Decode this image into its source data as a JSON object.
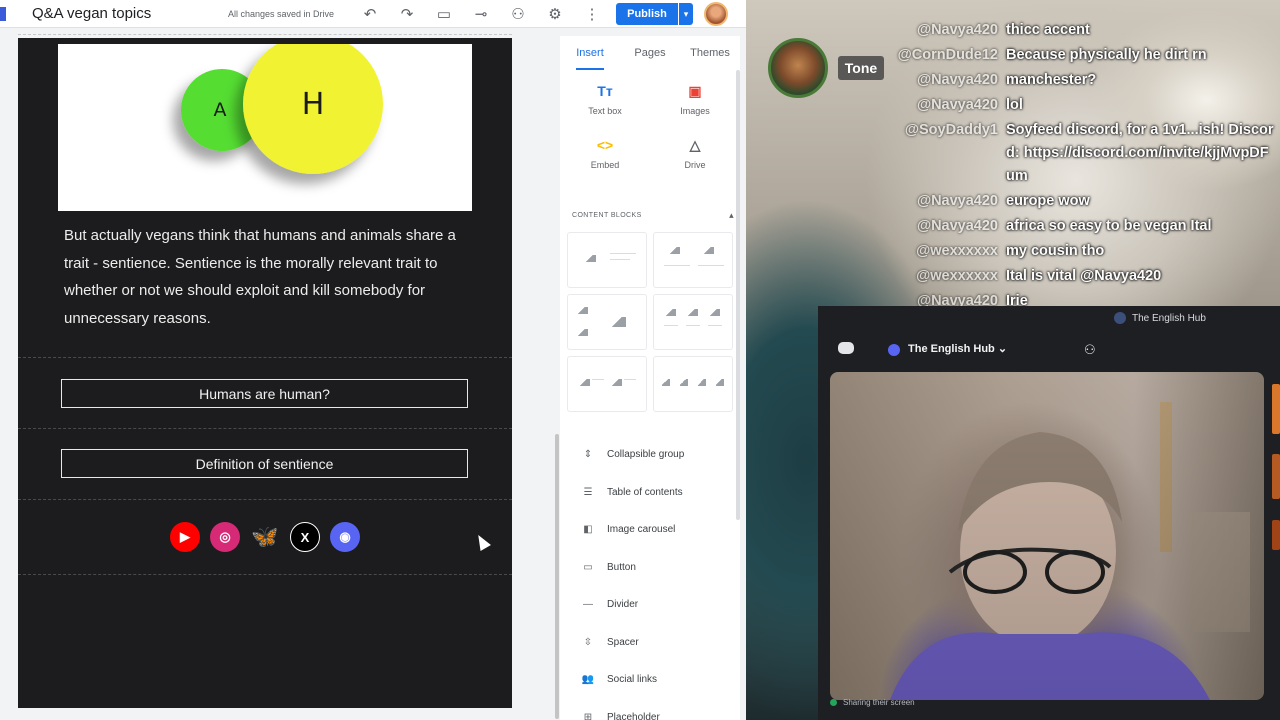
{
  "editor": {
    "title": "Q&A vegan topics",
    "save_status": "All changes saved in Drive",
    "publish_label": "Publish",
    "toolbar_icons": [
      "undo-icon",
      "redo-icon",
      "preview-icon",
      "link-icon",
      "share-icon",
      "settings-icon",
      "more-icon"
    ]
  },
  "page": {
    "venn": {
      "left_label": "A",
      "right_label": "H",
      "left_color": "#55dd33",
      "right_color": "#f1f230"
    },
    "paragraph": "But actually vegans think that humans and animals share a trait - sentience. Sentience is the morally relevant trait to whether or not we should exploit and kill somebody for unnecessary reasons.",
    "buttons": [
      "Humans are human?",
      "Definition of sentience"
    ],
    "social_icons": [
      {
        "name": "youtube-icon",
        "glyph": "▶",
        "color": "#ff0000"
      },
      {
        "name": "instagram-icon",
        "glyph": "◎",
        "color": "#d62976"
      },
      {
        "name": "bluesky-icon",
        "glyph": "🦋",
        "color": "#1185fe"
      },
      {
        "name": "x-icon",
        "glyph": "X",
        "color": "#000000"
      },
      {
        "name": "discord-icon",
        "glyph": "◉",
        "color": "#5865f2"
      }
    ]
  },
  "sidepanel": {
    "tabs": [
      "Insert",
      "Pages",
      "Themes"
    ],
    "insert_items": [
      {
        "label": "Text box",
        "icon": "text-box-icon",
        "glyph": "Tт",
        "color": "#1a73e8"
      },
      {
        "label": "Images",
        "icon": "images-icon",
        "glyph": "▣",
        "color": "#ea4335"
      },
      {
        "label": "Embed",
        "icon": "embed-icon",
        "glyph": "<>",
        "color": "#fbbc04"
      },
      {
        "label": "Drive",
        "icon": "drive-icon",
        "glyph": "△",
        "color": "#5f6368"
      }
    ],
    "content_blocks_heading": "CONTENT BLOCKS",
    "components": [
      {
        "label": "Collapsible group",
        "icon": "collapsible-icon",
        "glyph": "⇕"
      },
      {
        "label": "Table of contents",
        "icon": "toc-icon",
        "glyph": "☰"
      },
      {
        "label": "Image carousel",
        "icon": "carousel-icon",
        "glyph": "◧"
      },
      {
        "label": "Button",
        "icon": "button-icon",
        "glyph": "▭"
      },
      {
        "label": "Divider",
        "icon": "divider-icon",
        "glyph": "—"
      },
      {
        "label": "Spacer",
        "icon": "spacer-icon",
        "glyph": "⇳"
      },
      {
        "label": "Social links",
        "icon": "social-links-icon",
        "glyph": "👥"
      },
      {
        "label": "Placeholder",
        "icon": "placeholder-icon",
        "glyph": "⊞"
      }
    ]
  },
  "stream": {
    "streamer_name": "Tone",
    "chat": [
      {
        "user": "@Navya420",
        "text": "thicc accent"
      },
      {
        "user": "@CornDude12",
        "text": "Because physically he dirt rn"
      },
      {
        "user": "@Navya420",
        "text": "manchester?"
      },
      {
        "user": "@Navya420",
        "text": "lol"
      },
      {
        "user": "@SoyDaddy1",
        "text": "Soyfeed discord, for a 1v1...ish! Discord: https://discord.com/invite/kjjMvpDFum"
      },
      {
        "user": "@Navya420",
        "text": "europe wow"
      },
      {
        "user": "@Navya420",
        "text": "africa so easy to be vegan Ital"
      },
      {
        "user": "@wexxxxxx",
        "text": "my cousin tho"
      },
      {
        "user": "@wexxxxxx",
        "text": "Ital is vital @Navya420"
      },
      {
        "user": "@Navya420",
        "text": "Irie"
      }
    ],
    "discord": {
      "server_name": "The English Hub",
      "hub_label": "The English Hub",
      "sharing_label": "Sharing their screen"
    }
  }
}
